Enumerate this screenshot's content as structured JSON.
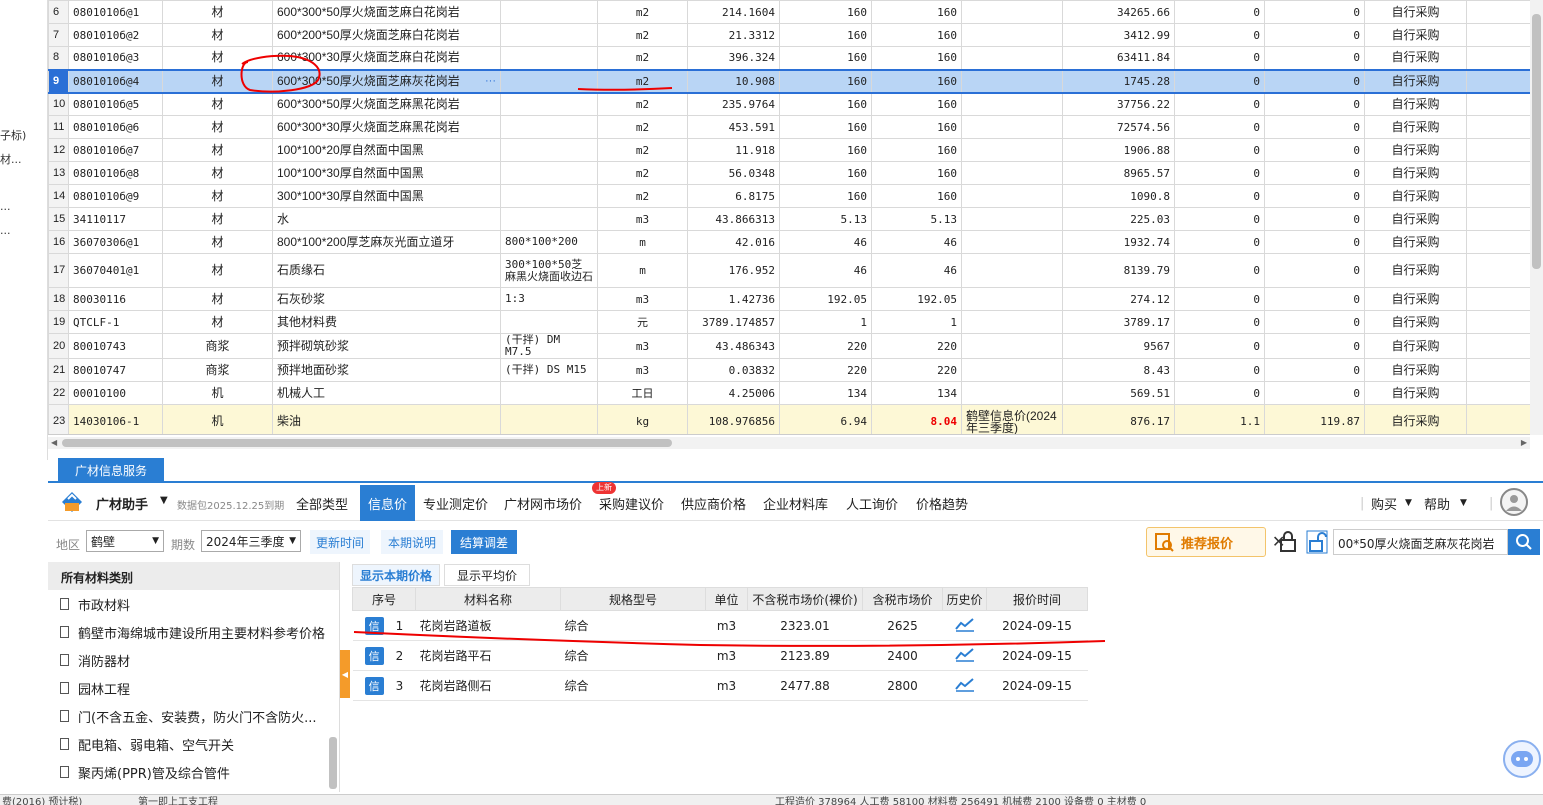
{
  "left_strip": [
    "子标)",
    "材...",
    "...",
    "..."
  ],
  "grid_rows": [
    {
      "no": "6",
      "code": "0801010б@1",
      "type": "材",
      "name": "600*300*50厚火烧面芝麻白花岗岩",
      "spec": "",
      "unit": "m2",
      "qty": "214.1604",
      "p1": "160",
      "p2": "160",
      "src": "",
      "amt": "34265.66",
      "a": "0",
      "b": "0",
      "supply": "自行采购"
    },
    {
      "no": "7",
      "code": "0801010б@2",
      "type": "材",
      "name": "600*200*50厚火烧面芝麻白花岗岩",
      "spec": "",
      "unit": "m2",
      "qty": "21.3312",
      "p1": "160",
      "p2": "160",
      "src": "",
      "amt": "3412.99",
      "a": "0",
      "b": "0",
      "supply": "自行采购"
    },
    {
      "no": "8",
      "code": "0801010б@3",
      "type": "材",
      "name": "600*300*30厚火烧面芝麻白花岗岩",
      "spec": "",
      "unit": "m2",
      "qty": "396.324",
      "p1": "160",
      "p2": "160",
      "src": "",
      "amt": "63411.84",
      "a": "0",
      "b": "0",
      "supply": "自行采购"
    },
    {
      "no": "9",
      "code": "0801010б@4",
      "type": "材",
      "name": "600*300*50厚火烧面芝麻灰花岗岩",
      "spec": "",
      "unit": "m2",
      "qty": "10.908",
      "p1": "160",
      "p2": "160",
      "src": "",
      "amt": "1745.28",
      "a": "0",
      "b": "0",
      "supply": "自行采购"
    },
    {
      "no": "10",
      "code": "0801010б@5",
      "type": "材",
      "name": "600*300*50厚火烧面芝麻黑花岗岩",
      "spec": "",
      "unit": "m2",
      "qty": "235.9764",
      "p1": "160",
      "p2": "160",
      "src": "",
      "amt": "37756.22",
      "a": "0",
      "b": "0",
      "supply": "自行采购"
    },
    {
      "no": "11",
      "code": "0801010б@6",
      "type": "材",
      "name": "600*300*30厚火烧面芝麻黑花岗岩",
      "spec": "",
      "unit": "m2",
      "qty": "453.591",
      "p1": "160",
      "p2": "160",
      "src": "",
      "amt": "72574.56",
      "a": "0",
      "b": "0",
      "supply": "自行采购"
    },
    {
      "no": "12",
      "code": "0801010б@7",
      "type": "材",
      "name": "100*100*20厚自然面中国黑",
      "spec": "",
      "unit": "m2",
      "qty": "11.918",
      "p1": "160",
      "p2": "160",
      "src": "",
      "amt": "1906.88",
      "a": "0",
      "b": "0",
      "supply": "自行采购"
    },
    {
      "no": "13",
      "code": "0801010б@8",
      "type": "材",
      "name": "100*100*30厚自然面中国黑",
      "spec": "",
      "unit": "m2",
      "qty": "56.0348",
      "p1": "160",
      "p2": "160",
      "src": "",
      "amt": "8965.57",
      "a": "0",
      "b": "0",
      "supply": "自行采购"
    },
    {
      "no": "14",
      "code": "0801010б@9",
      "type": "材",
      "name": "300*100*30厚自然面中国黑",
      "spec": "",
      "unit": "m2",
      "qty": "6.8175",
      "p1": "160",
      "p2": "160",
      "src": "",
      "amt": "1090.8",
      "a": "0",
      "b": "0",
      "supply": "自行采购"
    },
    {
      "no": "15",
      "code": "34110117",
      "type": "材",
      "name": "水",
      "spec": "",
      "unit": "m3",
      "qty": "43.866313",
      "p1": "5.13",
      "p2": "5.13",
      "src": "",
      "amt": "225.03",
      "a": "0",
      "b": "0",
      "supply": "自行采购"
    },
    {
      "no": "16",
      "code": "36070306@1",
      "type": "材",
      "name": "800*100*200厚芝麻灰光面立道牙",
      "spec": "800*100*200",
      "unit": "m",
      "qty": "42.016",
      "p1": "46",
      "p2": "46",
      "src": "",
      "amt": "1932.74",
      "a": "0",
      "b": "0",
      "supply": "自行采购"
    },
    {
      "no": "17",
      "code": "36070401@1",
      "type": "材",
      "name": "石质缘石",
      "spec": "300*100*50芝麻黑火烧面收边石",
      "unit": "m",
      "qty": "176.952",
      "p1": "46",
      "p2": "46",
      "src": "",
      "amt": "8139.79",
      "a": "0",
      "b": "0",
      "supply": "自行采购"
    },
    {
      "no": "18",
      "code": "80030116",
      "type": "材",
      "name": "石灰砂浆",
      "spec": "1:3",
      "unit": "m3",
      "qty": "1.42736",
      "p1": "192.05",
      "p2": "192.05",
      "src": "",
      "amt": "274.12",
      "a": "0",
      "b": "0",
      "supply": "自行采购"
    },
    {
      "no": "19",
      "code": "QTCLF-1",
      "type": "材",
      "name": "其他材料费",
      "spec": "",
      "unit": "元",
      "qty": "3789.174857",
      "p1": "1",
      "p2": "1",
      "src": "",
      "amt": "3789.17",
      "a": "0",
      "b": "0",
      "supply": "自行采购"
    },
    {
      "no": "20",
      "code": "80010743",
      "type": "商浆",
      "name": "预拌砌筑砂浆",
      "spec": "(干拌) DM M7.5",
      "unit": "m3",
      "qty": "43.486343",
      "p1": "220",
      "p2": "220",
      "src": "",
      "amt": "9567",
      "a": "0",
      "b": "0",
      "supply": "自行采购"
    },
    {
      "no": "21",
      "code": "80010747",
      "type": "商浆",
      "name": "预拌地面砂浆",
      "spec": "(干拌) DS M15",
      "unit": "m3",
      "qty": "0.03832",
      "p1": "220",
      "p2": "220",
      "src": "",
      "amt": "8.43",
      "a": "0",
      "b": "0",
      "supply": "自行采购"
    },
    {
      "no": "22",
      "code": "00010100",
      "type": "机",
      "name": "机械人工",
      "spec": "",
      "unit": "工日",
      "qty": "4.25006",
      "p1": "134",
      "p2": "134",
      "src": "",
      "amt": "569.51",
      "a": "0",
      "b": "0",
      "supply": "自行采购"
    },
    {
      "no": "23",
      "code": "14030106-1",
      "type": "机",
      "name": "柴油",
      "spec": "",
      "unit": "kg",
      "qty": "108.976856",
      "p1": "6.94",
      "p2": "8.04",
      "src": "鹤壁信息价(2024年三季度)",
      "amt": "876.17",
      "a": "1.1",
      "b": "119.87",
      "supply": "自行采购"
    }
  ],
  "panel_tab": "广材信息服务",
  "toolbar": {
    "title": "广材助手",
    "sub": "数据包2025.12.25到期",
    "menus": [
      "全部类型",
      "信息价",
      "专业测定价",
      "广材网市场价",
      "采购建议价",
      "供应商价格",
      "企业材料库",
      "人工询价",
      "价格趋势"
    ],
    "badge": "上新",
    "buy": "购买",
    "help": "帮助"
  },
  "filter": {
    "region_label": "地区",
    "region": "鹤壁",
    "period_label": "期数",
    "period": "2024年三季度",
    "btn_update": "更新时间",
    "btn_desc": "本期说明",
    "btn_settle": "结算调差",
    "recommend": "推荐报价",
    "search": "00*50厚火烧面芝麻灰花岗岩"
  },
  "sidebar": {
    "header": "所有材料类别",
    "items": [
      "市政材料",
      "鹤壁市海绵城市建设所用主要材料参考价格",
      "消防器材",
      "园林工程",
      "门(不含五金、安装费，防火门不含防火...",
      "配电箱、弱电箱、空气开关",
      "聚丙烯(PPR)管及综合管件"
    ]
  },
  "price_tabs": [
    "显示本期价格",
    "显示平均价"
  ],
  "price_headers": [
    "序号",
    "材料名称",
    "规格型号",
    "单位",
    "不含税市场价(裸价)",
    "含税市场价",
    "历史价",
    "报价时间"
  ],
  "price_rows": [
    {
      "tag": "信",
      "no": "1",
      "name": "花岗岩路道板",
      "spec": "综合",
      "unit": "m3",
      "notax": "2323.01",
      "tax": "2625",
      "date": "2024-09-15"
    },
    {
      "tag": "信",
      "no": "2",
      "name": "花岗岩路平石",
      "spec": "综合",
      "unit": "m3",
      "notax": "2123.89",
      "tax": "2400",
      "date": "2024-09-15"
    },
    {
      "tag": "信",
      "no": "3",
      "name": "花岗岩路侧石",
      "spec": "综合",
      "unit": "m3",
      "notax": "2477.88",
      "tax": "2800",
      "date": "2024-09-15"
    }
  ],
  "status": {
    "left": "费(2016) 预计税)",
    "mid": "第一即上工支工程",
    "right": "工程造价 378964  人工费 58100  材料费 256491  机械费 2100  设备费 0  主材费 0"
  },
  "colors": {
    "accent": "#2a7ed3",
    "selected": "#b9d5f5",
    "highlight_row": "#fdf8d6",
    "red_annotation": "#e00000"
  }
}
